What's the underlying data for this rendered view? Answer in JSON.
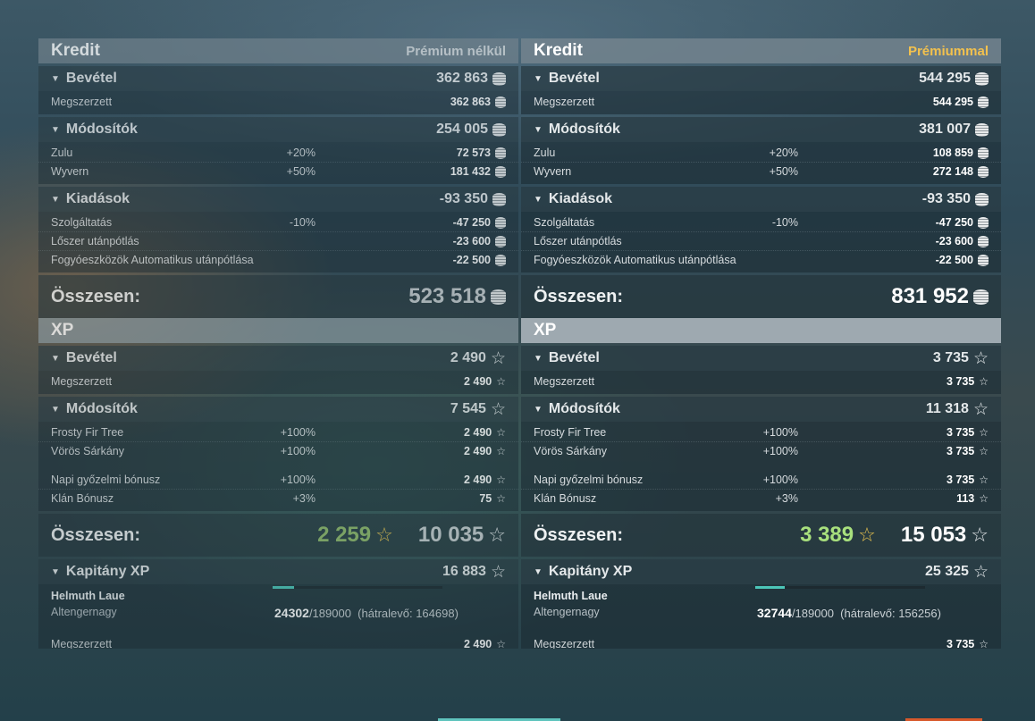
{
  "left": {
    "kredit_title": "Kredit",
    "kredit_mode": "Prémium nélkül",
    "income_title": "Bevétel",
    "income_total": "362 863",
    "income_rows": [
      {
        "label": "Megszerzett",
        "pct": "",
        "value": "362 863"
      }
    ],
    "mod_title": "Módosítók",
    "mod_total": "254 005",
    "mod_rows": [
      {
        "label": "Zulu",
        "pct": "+20%",
        "value": "72 573"
      },
      {
        "label": "Wyvern",
        "pct": "+50%",
        "value": "181 432"
      }
    ],
    "exp_title": "Kiadások",
    "exp_total": "-93 350",
    "exp_rows": [
      {
        "label": "Szolgáltatás",
        "pct": "-10%",
        "value": "-47 250"
      },
      {
        "label": "Lőszer utánpótlás",
        "pct": "",
        "value": "-23 600"
      },
      {
        "label": "Fogyóeszközök Automatikus utánpótlása",
        "pct": "",
        "value": "-22 500"
      }
    ],
    "total_label": "Összesen:",
    "kredit_total": "523 518",
    "xp_title": "XP",
    "xp_income_title": "Bevétel",
    "xp_income_total": "2 490",
    "xp_income_rows": [
      {
        "label": "Megszerzett",
        "pct": "",
        "value": "2 490"
      }
    ],
    "xp_mod_title": "Módosítók",
    "xp_mod_total": "7 545",
    "xp_mod_rows_a": [
      {
        "label": "Frosty Fir Tree",
        "pct": "+100%",
        "value": "2 490"
      },
      {
        "label": "Vörös Sárkány",
        "pct": "+100%",
        "value": "2 490"
      }
    ],
    "xp_mod_rows_b": [
      {
        "label": "Napi győzelmi bónusz",
        "pct": "+100%",
        "value": "2 490"
      },
      {
        "label": "Klán Bónusz",
        "pct": "+3%",
        "value": "75"
      }
    ],
    "xp_total_label": "Összesen:",
    "xp_total_ship": "2 259",
    "xp_total_free": "10 035",
    "captain_title": "Kapitány XP",
    "captain_total": "16 883",
    "captain_name": "Helmuth Laue",
    "captain_rank": "Altengernagy",
    "captain_progress_value": "24302",
    "captain_progress_max": "/189000",
    "captain_remaining": "(hátralevő: 164698)",
    "captain_progress_fraction": 0.1286,
    "captain_earned_label": "Megszerzett",
    "captain_earned_value": "2 490"
  },
  "right": {
    "kredit_title": "Kredit",
    "kredit_mode": "Prémiummal",
    "income_title": "Bevétel",
    "income_total": "544 295",
    "income_rows": [
      {
        "label": "Megszerzett",
        "pct": "",
        "value": "544 295"
      }
    ],
    "mod_title": "Módosítók",
    "mod_total": "381 007",
    "mod_rows": [
      {
        "label": "Zulu",
        "pct": "+20%",
        "value": "108 859"
      },
      {
        "label": "Wyvern",
        "pct": "+50%",
        "value": "272 148"
      }
    ],
    "exp_title": "Kiadások",
    "exp_total": "-93 350",
    "exp_rows": [
      {
        "label": "Szolgáltatás",
        "pct": "-10%",
        "value": "-47 250"
      },
      {
        "label": "Lőszer utánpótlás",
        "pct": "",
        "value": "-23 600"
      },
      {
        "label": "Fogyóeszközök Automatikus utánpótlása",
        "pct": "",
        "value": "-22 500"
      }
    ],
    "total_label": "Összesen:",
    "kredit_total": "831 952",
    "xp_title": "XP",
    "xp_income_title": "Bevétel",
    "xp_income_total": "3 735",
    "xp_income_rows": [
      {
        "label": "Megszerzett",
        "pct": "",
        "value": "3 735"
      }
    ],
    "xp_mod_title": "Módosítók",
    "xp_mod_total": "11 318",
    "xp_mod_rows_a": [
      {
        "label": "Frosty Fir Tree",
        "pct": "+100%",
        "value": "3 735"
      },
      {
        "label": "Vörös Sárkány",
        "pct": "+100%",
        "value": "3 735"
      }
    ],
    "xp_mod_rows_b": [
      {
        "label": "Napi győzelmi bónusz",
        "pct": "+100%",
        "value": "3 735"
      },
      {
        "label": "Klán Bónusz",
        "pct": "+3%",
        "value": "113"
      }
    ],
    "xp_total_label": "Összesen:",
    "xp_total_ship": "3 389",
    "xp_total_free": "15 053",
    "captain_title": "Kapitány XP",
    "captain_total": "25 325",
    "captain_name": "Helmuth Laue",
    "captain_rank": "Altengernagy",
    "captain_progress_value": "32744",
    "captain_progress_max": "/189000",
    "captain_remaining": "(hátralevő: 156256)",
    "captain_progress_fraction": 0.1732,
    "captain_earned_label": "Megszerzett",
    "captain_earned_value": "3 735"
  },
  "icons": {
    "credit": "credit-coin-icon",
    "xp": "xp-star-icon",
    "expand": "caret-down-icon"
  },
  "colors": {
    "premium_accent": "#f2c14e",
    "ship_xp_green": "#a8e07d",
    "progress_teal": "#4cc6b8"
  }
}
